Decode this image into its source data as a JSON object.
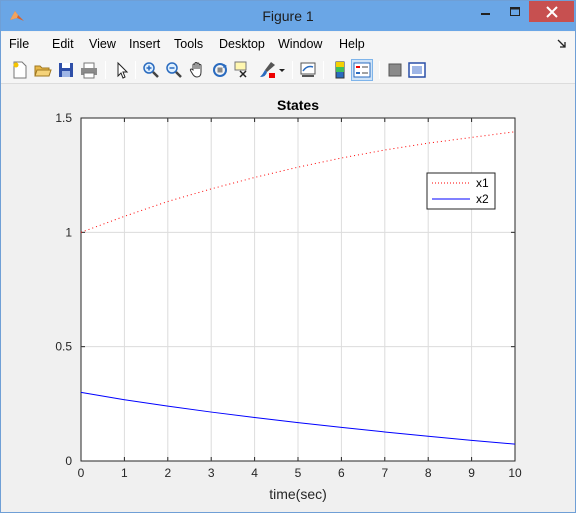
{
  "window": {
    "title": "Figure 1"
  },
  "menu": [
    "File",
    "Edit",
    "View",
    "Insert",
    "Tools",
    "Desktop",
    "Window",
    "Help"
  ],
  "toolbar": {
    "icons": [
      "new-figure-icon",
      "open-file-icon",
      "save-icon",
      "print-icon",
      "edit-plot-arrow-icon",
      "zoom-in-icon",
      "zoom-out-icon",
      "pan-hand-icon",
      "rotate-3d-icon",
      "data-cursor-icon",
      "brush-icon",
      "brush-dropdown-icon",
      "link-plot-icon",
      "insert-colorbar-icon",
      "insert-legend-icon",
      "hide-plot-tools-icon",
      "show-plot-tools-icon"
    ]
  },
  "chart_data": {
    "type": "line",
    "title": "States",
    "xlabel": "time(sec)",
    "ylabel": "",
    "xlim": [
      0,
      10
    ],
    "ylim": [
      0,
      1.5
    ],
    "grid": true,
    "xticks": [
      "0",
      "1",
      "2",
      "3",
      "4",
      "5",
      "6",
      "7",
      "8",
      "9",
      "10"
    ],
    "yticks": [
      "0",
      "0.5",
      "1",
      "1.5"
    ],
    "legend_position": "top-right",
    "x": [
      0,
      1,
      2,
      3,
      4,
      5,
      6,
      7,
      8,
      9,
      10
    ],
    "series": [
      {
        "name": "x1",
        "color": "#ff0000",
        "style": "dotted",
        "values": [
          1.0,
          1.07,
          1.135,
          1.19,
          1.24,
          1.285,
          1.325,
          1.36,
          1.39,
          1.415,
          1.44
        ]
      },
      {
        "name": "x2",
        "color": "#0000ff",
        "style": "solid",
        "values": [
          0.3,
          0.268,
          0.24,
          0.214,
          0.19,
          0.168,
          0.147,
          0.127,
          0.108,
          0.09,
          0.074
        ]
      }
    ]
  }
}
